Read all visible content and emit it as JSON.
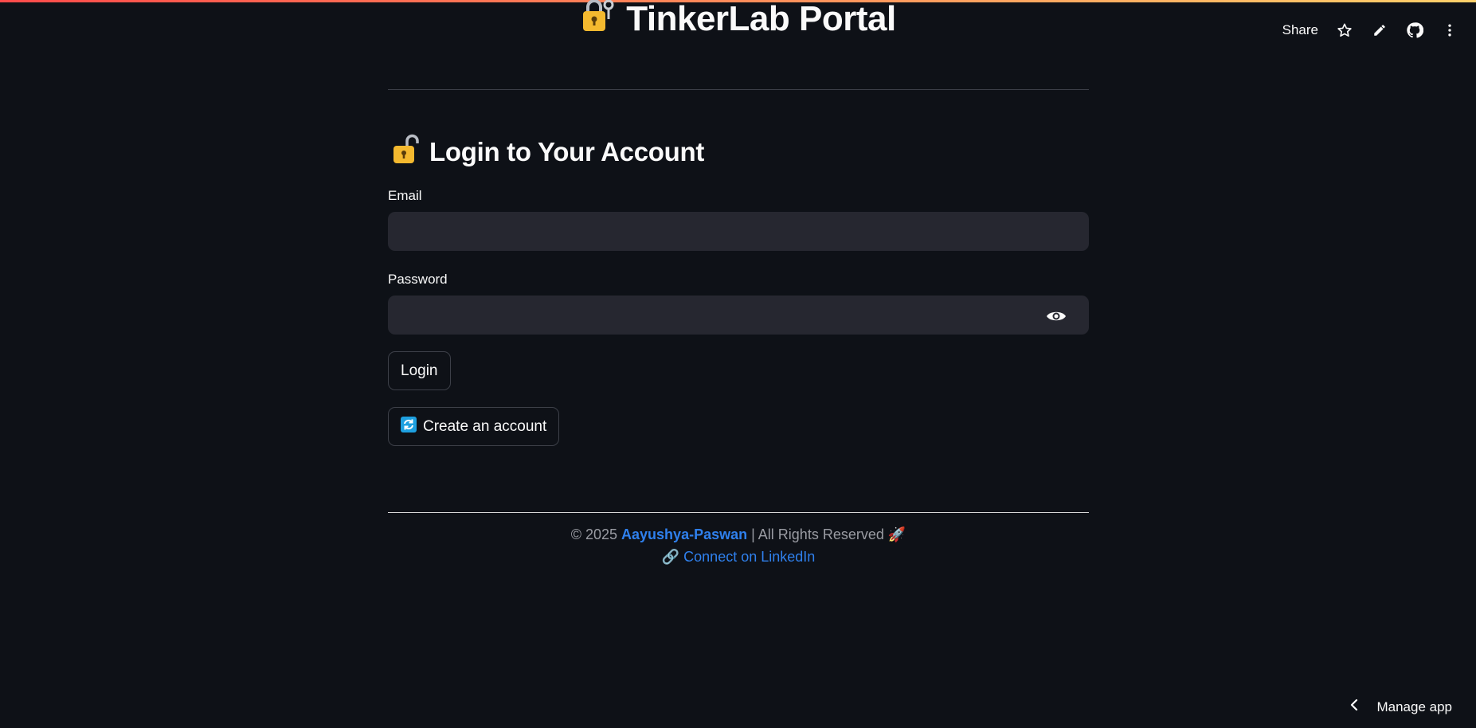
{
  "app": {
    "title": "TinkerLab Portal",
    "title_icon": "lock-with-key-icon"
  },
  "toolbar": {
    "share_label": "Share",
    "icons": [
      "star-icon",
      "pencil-icon",
      "github-icon",
      "more-vertical-icon"
    ]
  },
  "login": {
    "heading": "Login to Your Account",
    "heading_icon": "unlocked-padlock-icon",
    "email_label": "Email",
    "email_value": "",
    "password_label": "Password",
    "password_value": "",
    "login_button": "Login",
    "create_account_button": "Create an account",
    "create_account_icon": "refresh-arrows-icon"
  },
  "footer": {
    "copyright_prefix": "© 2025 ",
    "author": "Aayushya-Paswan",
    "copyright_suffix": " | All Rights Reserved 🚀",
    "link_icon": "🔗",
    "linkedin_label": "Connect on LinkedIn"
  },
  "manage_app": {
    "label": "Manage app"
  },
  "colors": {
    "background": "#0e1117",
    "input_background": "#262730",
    "link": "#2f80ed",
    "lock_gold": "#f4b92f"
  }
}
